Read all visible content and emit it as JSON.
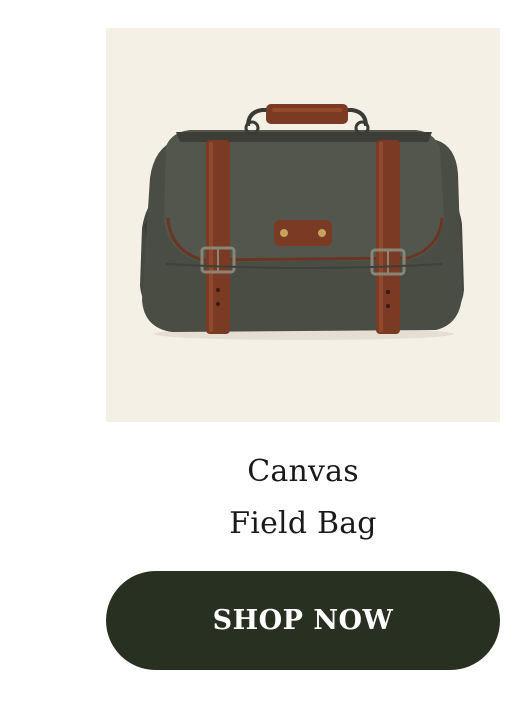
{
  "product": {
    "image_icon": "canvas-field-bag-image",
    "title_line1": "Canvas",
    "title_line2": "Field Bag"
  },
  "cta": {
    "label": "SHOP NOW"
  },
  "colors": {
    "image_background": "#f4f0e6",
    "button_background": "#283021",
    "button_text": "#ffffff",
    "title_text": "#1a1a1a",
    "canvas": "#4a4d44",
    "leather": "#7a3a24"
  }
}
